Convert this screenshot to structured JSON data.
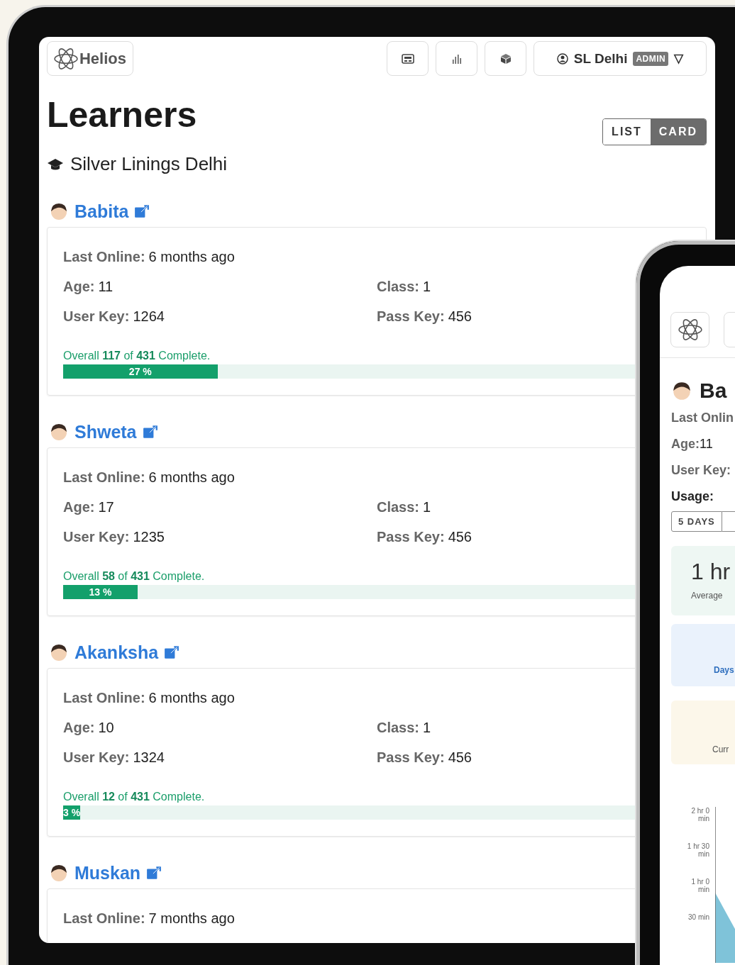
{
  "topbar": {
    "logo": "Helios",
    "icon_buttons": [
      {
        "kind": "id-card"
      },
      {
        "kind": "chart"
      },
      {
        "kind": "cube"
      }
    ],
    "user": {
      "name": "SL Delhi",
      "badge": "ADMIN",
      "caret": "▽"
    }
  },
  "page": {
    "title": "Learners",
    "school": "Silver Linings Delhi",
    "view_toggle": [
      {
        "label": "LIST",
        "selected": false
      },
      {
        "label": "CARD",
        "selected": true
      }
    ]
  },
  "learners": [
    {
      "name": "Babita",
      "last_online": {
        "label": "Last Online:",
        "value": "6 months ago"
      },
      "age": {
        "label": "Age:",
        "value": "11"
      },
      "class": {
        "label": "Class:",
        "value": "1"
      },
      "user_key": {
        "label": "User Key:",
        "value": "1264"
      },
      "pass_key": {
        "label": "Pass Key:",
        "value": "456"
      },
      "progress": {
        "text": "Overall **117** of **431** Complete.",
        "level": 0.27,
        "reading": "27 %"
      }
    },
    {
      "name": "Shweta",
      "last_online": {
        "label": "Last Online:",
        "value": "6 months ago"
      },
      "age": {
        "label": "Age:",
        "value": "17"
      },
      "class": {
        "label": "Class:",
        "value": "1"
      },
      "user_key": {
        "label": "User Key:",
        "value": "1235"
      },
      "pass_key": {
        "label": "Pass Key:",
        "value": "456"
      },
      "progress": {
        "text": "Overall **58** of **431** Complete.",
        "level": 0.13,
        "reading": "13 %"
      }
    },
    {
      "name": "Akanksha",
      "last_online": {
        "label": "Last Online:",
        "value": "6 months ago"
      },
      "age": {
        "label": "Age:",
        "value": "10"
      },
      "class": {
        "label": "Class:",
        "value": "1"
      },
      "user_key": {
        "label": "User Key:",
        "value": "1324"
      },
      "pass_key": {
        "label": "Pass Key:",
        "value": "456"
      },
      "progress": {
        "text": "Overall **12** of **431** Complete.",
        "level": 0.03,
        "reading": "3 %"
      }
    },
    {
      "name": "Muskan",
      "last_online": {
        "label": "Last Online:",
        "value": "7 months ago"
      }
    }
  ],
  "phone": {
    "name": "Ba",
    "rows": [
      {
        "label": "Last Onlin"
      },
      {
        "label": "Age:",
        "value": "11"
      },
      {
        "label": "User Key:"
      }
    ],
    "usage_label": "Usage:",
    "usage_range": "5 DAYS",
    "stats": [
      {
        "kind": "average",
        "value": "1 hr",
        "caption": "Average"
      },
      {
        "kind": "days",
        "caption": "Days"
      },
      {
        "kind": "current",
        "caption": "Curr"
      }
    ],
    "chart_ticks": [
      "2 hr 0 min",
      "1 hr 30 min",
      "1 hr 0 min",
      "30 min"
    ]
  }
}
